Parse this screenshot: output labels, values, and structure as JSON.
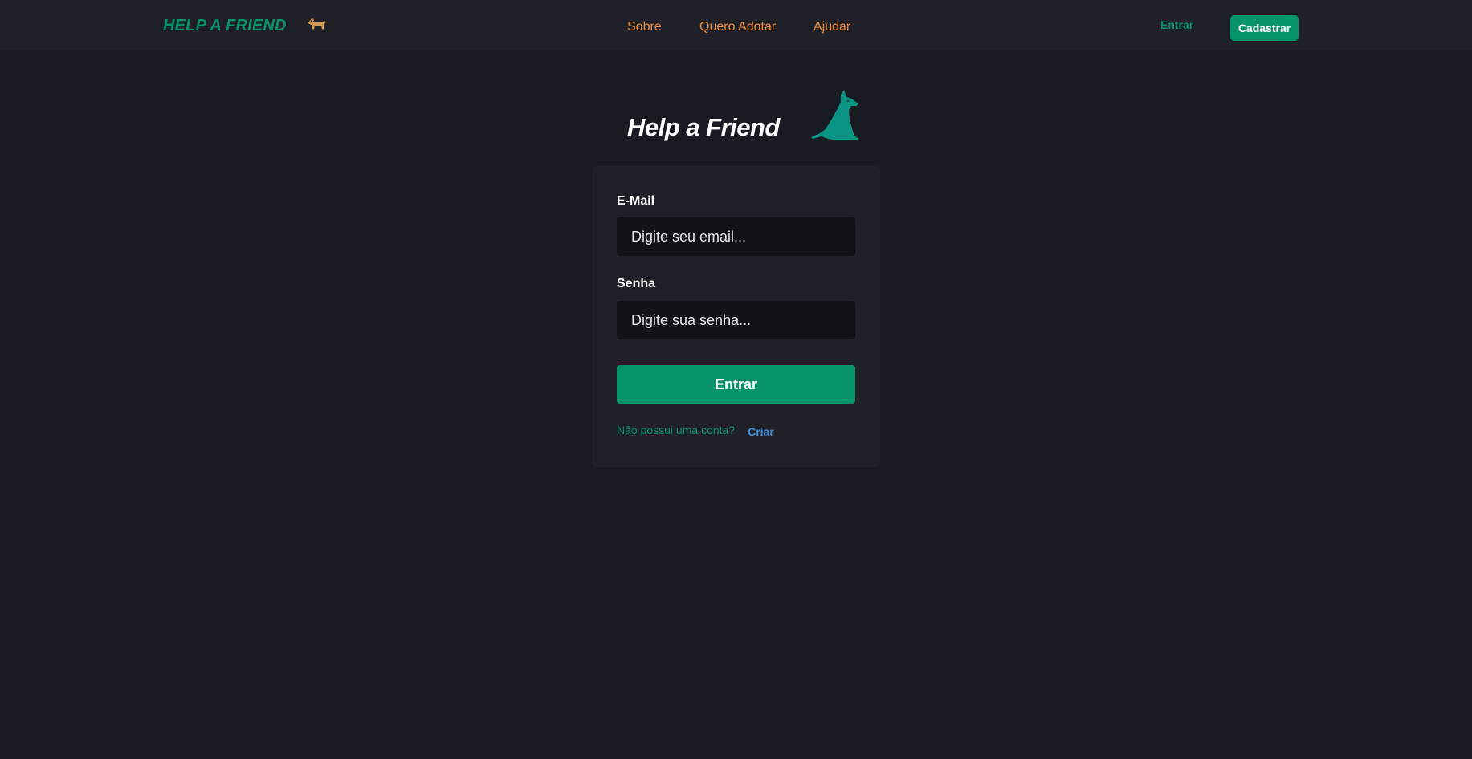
{
  "navbar": {
    "brand": "HELP A FRIEND",
    "brand_icon": "dog-emoji-icon",
    "links": [
      "Sobre",
      "Quero Adotar",
      "Ajudar"
    ],
    "login_label": "Entrar",
    "signup_label": "Cadastrar"
  },
  "hero": {
    "title": "Help a Friend",
    "icon": "sitting-dog-icon"
  },
  "form": {
    "email_label": "E-Mail",
    "email_placeholder": "Digite seu email...",
    "password_label": "Senha",
    "password_placeholder": "Digite sua senha...",
    "submit_label": "Entrar",
    "no_account_text": "Não possui uma conta?",
    "create_link": "Criar"
  },
  "colors": {
    "accent_green": "#07936a",
    "nav_link_orange": "#ed8836",
    "link_blue": "#3f8fd6",
    "background": "#191b23",
    "surface": "#202029"
  }
}
